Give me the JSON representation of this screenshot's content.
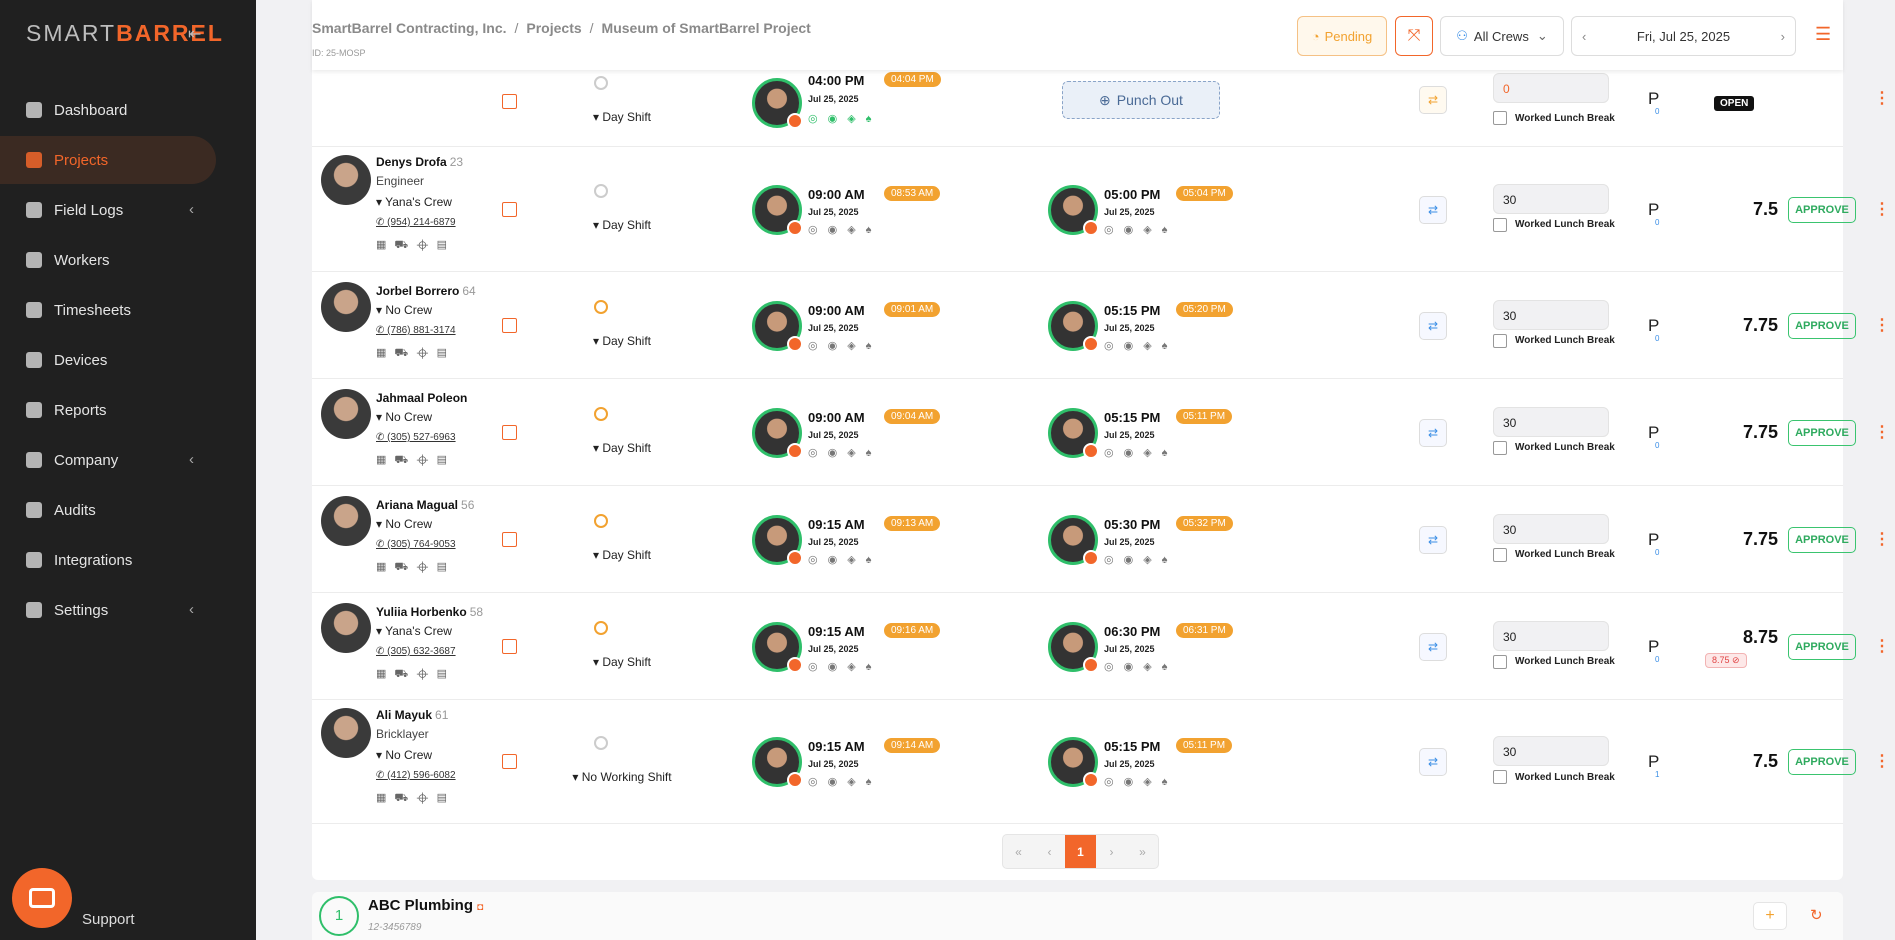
{
  "sidebar": {
    "logo_pre": "SMART",
    "logo_brand": "BARREL",
    "items": [
      {
        "label": "Dashboard",
        "icon": "dashboard-icon",
        "chevron": ""
      },
      {
        "label": "Projects",
        "icon": "projects-icon",
        "chevron": ""
      },
      {
        "label": "Field Logs",
        "icon": "field-logs-icon",
        "chevron": "‹"
      },
      {
        "label": "Workers",
        "icon": "workers-icon",
        "chevron": ""
      },
      {
        "label": "Timesheets",
        "icon": "timesheets-icon",
        "chevron": ""
      },
      {
        "label": "Devices",
        "icon": "devices-icon",
        "chevron": ""
      },
      {
        "label": "Reports",
        "icon": "reports-icon",
        "chevron": ""
      },
      {
        "label": "Company",
        "icon": "company-icon",
        "chevron": "‹"
      },
      {
        "label": "Audits",
        "icon": "audits-icon",
        "chevron": ""
      },
      {
        "label": "Integrations",
        "icon": "integrations-icon",
        "chevron": ""
      },
      {
        "label": "Settings",
        "icon": "settings-icon",
        "chevron": "‹"
      }
    ],
    "support": "Support"
  },
  "header": {
    "crumb1": "SmartBarrel Contracting, Inc.",
    "crumb2": "Projects",
    "crumb3": "Museum of SmartBarrel Project",
    "id": "ID: 25-MOSP",
    "pending": "Pending",
    "crews": "All Crews",
    "date": "Fri, Jul 25, 2025"
  },
  "top_row": {
    "shift": "Day Shift",
    "in_time": "04:00 PM",
    "in_badge": "04:04 PM",
    "in_date": "Jul 25, 2025",
    "punch_out": "Punch Out",
    "lunch": "0",
    "lunch_label": "Worked Lunch Break",
    "p": "P",
    "p_sub": "0",
    "status": "OPEN"
  },
  "workers": [
    {
      "name": "Denys Drofa",
      "age": "23",
      "role": "Engineer",
      "crew": "Yana's Crew",
      "phone": "(954) 214-6879",
      "shift": "Day Shift",
      "in_time": "09:00 AM",
      "in_badge": "08:53 AM",
      "in_date": "Jul 25, 2025",
      "out_time": "05:00 PM",
      "out_badge": "05:04 PM",
      "out_date": "Jul 25, 2025",
      "lunch": "30",
      "lunch_label": "Worked Lunch Break",
      "p": "P",
      "p_sub": "0",
      "hours": "7.5",
      "warn": "",
      "approve": "APPROVE"
    },
    {
      "name": "Jorbel Borrero",
      "age": "64",
      "role": "",
      "crew": "No Crew",
      "phone": "(786) 881-3174",
      "shift": "Day Shift",
      "in_time": "09:00 AM",
      "in_badge": "09:01 AM",
      "in_date": "Jul 25, 2025",
      "out_time": "05:15 PM",
      "out_badge": "05:20 PM",
      "out_date": "Jul 25, 2025",
      "lunch": "30",
      "lunch_label": "Worked Lunch Break",
      "p": "P",
      "p_sub": "0",
      "hours": "7.75",
      "warn": "",
      "approve": "APPROVE"
    },
    {
      "name": "Jahmaal Poleon",
      "age": "",
      "role": "",
      "crew": "No Crew",
      "phone": "(305) 527-6963",
      "shift": "Day Shift",
      "in_time": "09:00 AM",
      "in_badge": "09:04 AM",
      "in_date": "Jul 25, 2025",
      "out_time": "05:15 PM",
      "out_badge": "05:11 PM",
      "out_date": "Jul 25, 2025",
      "lunch": "30",
      "lunch_label": "Worked Lunch Break",
      "p": "P",
      "p_sub": "0",
      "hours": "7.75",
      "warn": "",
      "approve": "APPROVE"
    },
    {
      "name": "Ariana Magual",
      "age": "56",
      "role": "",
      "crew": "No Crew",
      "phone": "(305) 764-9053",
      "shift": "Day Shift",
      "in_time": "09:15 AM",
      "in_badge": "09:13 AM",
      "in_date": "Jul 25, 2025",
      "out_time": "05:30 PM",
      "out_badge": "05:32 PM",
      "out_date": "Jul 25, 2025",
      "lunch": "30",
      "lunch_label": "Worked Lunch Break",
      "p": "P",
      "p_sub": "0",
      "hours": "7.75",
      "warn": "",
      "approve": "APPROVE"
    },
    {
      "name": "Yuliia Horbenko",
      "age": "58",
      "role": "",
      "crew": "Yana's Crew",
      "phone": "(305) 632-3687",
      "shift": "Day Shift",
      "in_time": "09:15 AM",
      "in_badge": "09:16 AM",
      "in_date": "Jul 25, 2025",
      "out_time": "06:30 PM",
      "out_badge": "06:31 PM",
      "out_date": "Jul 25, 2025",
      "lunch": "30",
      "lunch_label": "Worked Lunch Break",
      "p": "P",
      "p_sub": "0",
      "hours": "8.75",
      "warn": "8.75 ⊘",
      "approve": "APPROVE"
    },
    {
      "name": "Ali Mayuk",
      "age": "61",
      "role": "Bricklayer",
      "crew": "No Crew",
      "phone": "(412) 596-6082",
      "shift": "No Working Shift",
      "in_time": "09:15 AM",
      "in_badge": "09:14 AM",
      "in_date": "Jul 25, 2025",
      "out_time": "05:15 PM",
      "out_badge": "05:11 PM",
      "out_date": "Jul 25, 2025",
      "lunch": "30",
      "lunch_label": "Worked Lunch Break",
      "p": "P",
      "p_sub": "1",
      "hours": "7.5",
      "warn": "",
      "approve": "APPROVE"
    }
  ],
  "pagination": {
    "first": "«",
    "prev": "‹",
    "current": "1",
    "next": "›",
    "last": "»"
  },
  "bottom": {
    "count": "1",
    "company": "ABC Plumbing",
    "sub": "12-3456789"
  },
  "colors": {
    "accent": "#f2662a",
    "warning": "#f2a230",
    "success": "#2fbf6a",
    "sidebar": "#202020"
  }
}
